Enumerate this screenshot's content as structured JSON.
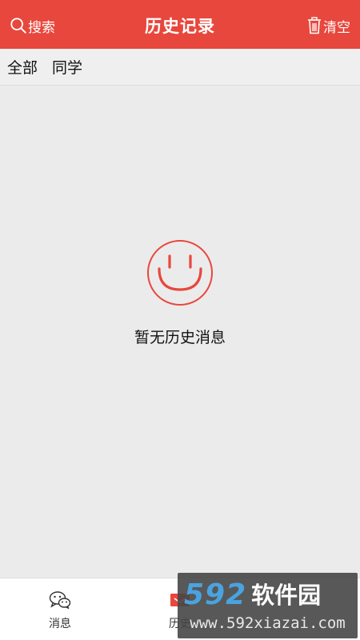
{
  "header": {
    "search_label": "搜索",
    "title": "历史记录",
    "clear_label": "清空",
    "background": "#e8473d"
  },
  "filters": [
    {
      "label": "全部"
    },
    {
      "label": "同学"
    }
  ],
  "empty_state": {
    "icon": "smiley-icon",
    "message": "暂无历史消息"
  },
  "bottom_nav": [
    {
      "label": "消息",
      "icon": "chat-icon"
    },
    {
      "label": "历史",
      "icon": "history-icon",
      "active": true
    }
  ],
  "watermark": {
    "brand_number": "592",
    "brand_text": "软件园",
    "url": "www.592xiazai.com"
  }
}
